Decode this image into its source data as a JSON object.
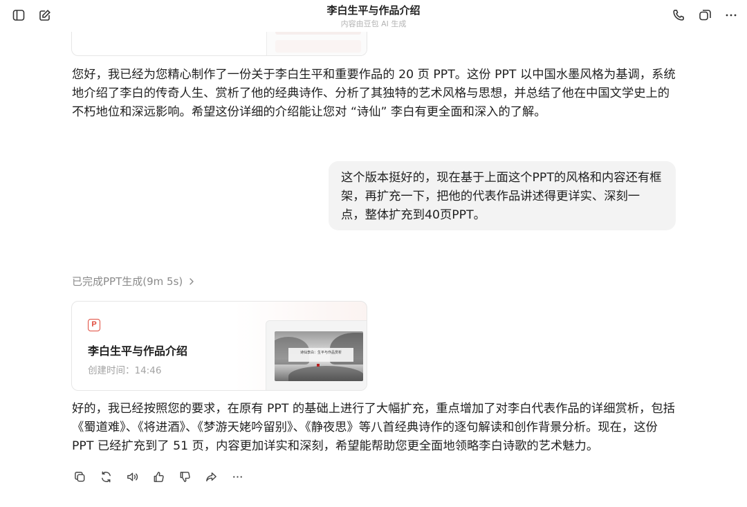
{
  "header": {
    "title": "李白生平与作品介绍",
    "subtitle": "内容由豆包 AI 生成",
    "left_icons": [
      "sidebar-toggle-icon",
      "new-chat-icon"
    ],
    "right_icons": [
      "phone-icon",
      "video-call-icon",
      "more-icon"
    ]
  },
  "conversation": {
    "assistant_message_1": "您好，我已经为您精心制作了一份关于李白生平和重要作品的 20 页 PPT。这份 PPT 以中国水墨风格为基调，系统地介绍了李白的传奇人生、赏析了他的经典诗作、分析了其独特的艺术风格与思想，并总结了他在中国文学史上的不朽地位和深远影响。希望这份详细的介绍能让您对 “诗仙” 李白有更全面和深入的了解。",
    "user_message": "这个版本挺好的，现在基于上面这个PPT的风格和内容还有框架，再扩充一下，把他的代表作品讲述得更详实、深刻一点，整体扩充到40页PPT。",
    "generation_status": "已完成PPT生成(9m 5s)",
    "ppt_card": {
      "badge": "P",
      "title": "李白生平与作品介绍",
      "created_label": "创建时间：14:46",
      "slide_title": "诗仙李白：生平与作品赏析"
    },
    "assistant_message_2": "好的，我已经按照您的要求，在原有 PPT 的基础上进行了大幅扩充，重点增加了对李白代表作品的详细赏析，包括《蜀道难》、《将进酒》、《梦游天姥吟留别》、《静夜思》等八首经典诗作的逐句解读和创作背景分析。现在，这份 PPT 已经扩充到了 51 页，内容更加详实和深刻，希望能帮助您更全面地领略李白诗歌的艺术魅力。"
  },
  "action_bar": [
    "copy-icon",
    "regenerate-icon",
    "read-aloud-icon",
    "like-icon",
    "dislike-icon",
    "share-icon",
    "more-icon"
  ],
  "colors": {
    "accent_red": "#e04a3c",
    "bubble_bg": "#f3f3f3",
    "muted_text": "#8a8a8a",
    "icon_stroke": "#333333"
  }
}
